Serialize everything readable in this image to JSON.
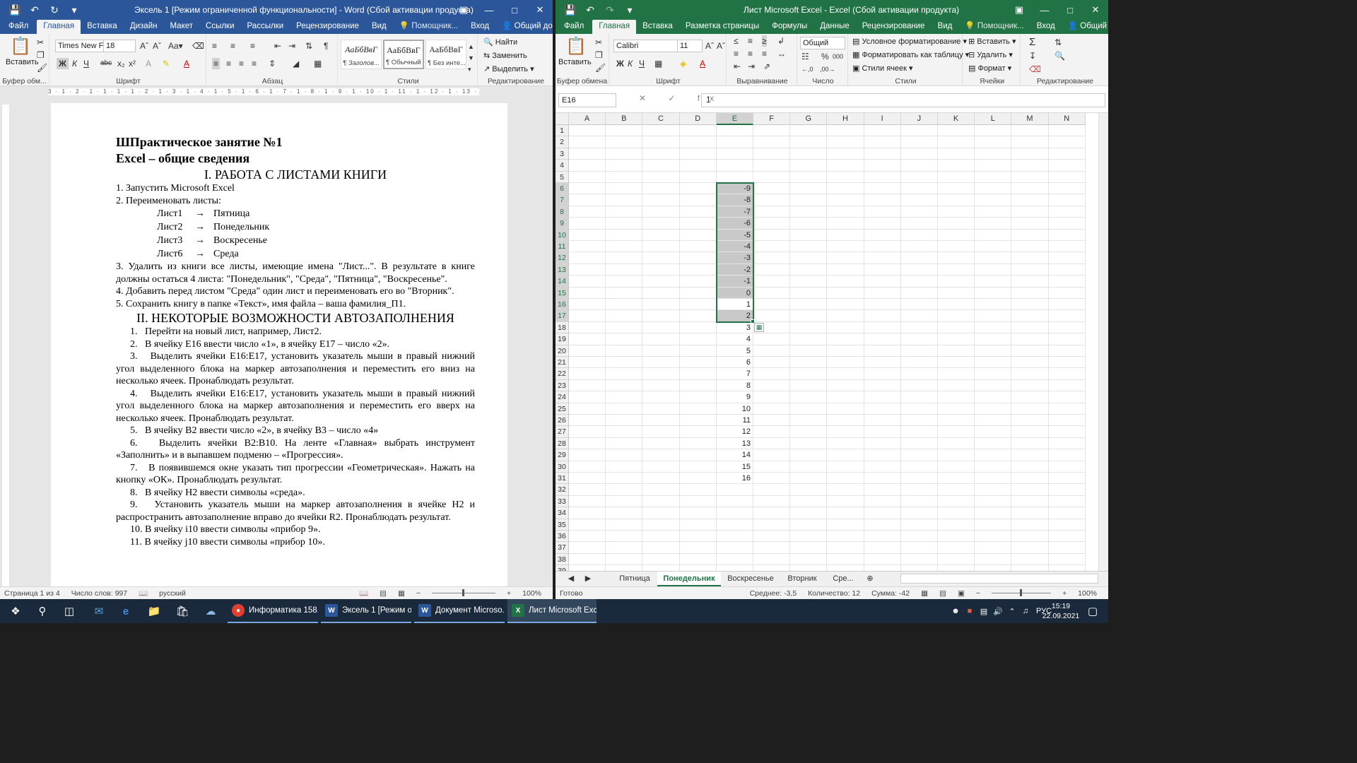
{
  "word": {
    "title": "Эксель 1 [Режим ограниченной функциональности] - Word (Сбой активации продукта)",
    "tabs": [
      "Файл",
      "Главная",
      "Вставка",
      "Дизайн",
      "Макет",
      "Ссылки",
      "Рассылки",
      "Рецензирование",
      "Вид",
      "Помощник...",
      "Вход",
      "Общий доступ"
    ],
    "ribbon": {
      "paste": "Вставить",
      "font_name": "Times New F",
      "font_size": "18",
      "styles": [
        {
          "preview": "АаБбВвГ",
          "name": "¶ Заголов..."
        },
        {
          "preview": "АаБбВвГ",
          "name": "¶ Обычный"
        },
        {
          "preview": "АаБбВвГ",
          "name": "¶ Без инте..."
        }
      ],
      "find": "Найти",
      "replace": "Заменить",
      "select": "Выделить",
      "groups": [
        "Буфер обм...",
        "Шрифт",
        "Абзац",
        "Стили",
        "Редактирование"
      ]
    },
    "ruler_text": "3 · 1 · 2 · 1 · 1 · 1 · 1 · 2 · 1 · 3 · 1 · 4 · 1 · 5 · 1 · 6 · 1 · 7 · 1 · 8 · 1 · 9 · 1 · 10 · 1 · 11 · 1 · 12 · 1 · 13 · 1 · 14 · 1 · 15 · 1 · 16 · 1 · 17",
    "doc": {
      "title1": "ШПрактическое занятие №1",
      "title2": "Excel – общие сведения",
      "section1": "I. РАБОТА С ЛИСТАМИ КНИГИ",
      "item1": "1. Запустить Microsoft Excel",
      "item2": "2. Переименовать листы:",
      "renames": [
        {
          "from": "Лист1",
          "arrow": "→",
          "to": "Пятница"
        },
        {
          "from": "Лист2",
          "arrow": "→",
          "to": "Понедельник"
        },
        {
          "from": "Лист3",
          "arrow": "→",
          "to": "Воскресенье"
        },
        {
          "from": "Лист6",
          "arrow": "→",
          "to": "Среда"
        }
      ],
      "item3": "3. Удалить из книги все листы, имеющие имена \"Лист...\". В результате в книге должны остаться 4 листа: \"Понедельник\", \"Среда\", \"Пятница\", \"Воскресенье\".",
      "item4": "4. Добавить перед листом \"Среда\" один лист и переименовать его во \"Вторник\".",
      "item5": "5. Сохранить книгу в папке «Текст», имя файла – ваша фамилия_П1.",
      "section2": "II. НЕКОТОРЫЕ ВОЗМОЖНОСТИ АВТОЗАПОЛНЕНИЯ",
      "steps": [
        "1.   Перейти на новый лист, например, Лист2.",
        "2.   В ячейку Е16 ввести число «1», в ячейку Е17 – число «2».",
        "3.   Выделить ячейки Е16:Е17, установить указатель мыши в правый нижний угол выделенного блока на маркер автозаполнения и переместить его вниз на несколько ячеек. Пронаблюдать результат.",
        "4.   Выделить ячейки Е16:Е17, установить указатель мыши в правый нижний угол выделенного блока на маркер автозаполнения и переместить его вверх на несколько ячеек. Пронаблюдать результат.",
        "5.   В ячейку В2 ввести число «2», в ячейку В3 – число «4»",
        "6.   Выделить ячейки В2:В10. На ленте «Главная» выбрать инструмент «Заполнить» и в выпавшем подменю – «Прогрессия».",
        "7.   В появившемся окне указать тип прогрессии «Геометрическая». Нажать на кнопку «ОК». Пронаблюдать результат.",
        "8.   В ячейку Н2 ввести символы «среда».",
        "9.   Установить указатель мыши на маркер автозаполнения в ячейке Н2 и распространить автозаполнение вправо до ячейки R2. Пронаблюдать результат.",
        "10. В ячейку i10 ввести символы «прибор 9».",
        "11. В ячейку j10 ввести символы «прибор 10»."
      ]
    },
    "status": {
      "page": "Страница 1 из 4",
      "words": "Число слов: 997",
      "lang": "русский",
      "zoom": "100%"
    }
  },
  "excel": {
    "title": "Лист Microsoft Excel - Excel (Сбой активации продукта)",
    "tabs": [
      "Файл",
      "Главная",
      "Вставка",
      "Разметка страницы",
      "Формулы",
      "Данные",
      "Рецензирование",
      "Вид",
      "Помощник...",
      "Вход",
      "Общий доступ"
    ],
    "ribbon": {
      "paste": "Вставить",
      "font_name": "Calibri",
      "font_size": "11",
      "number_format": "Общий",
      "cond_format": "Условное форматирование",
      "format_table": "Форматировать как таблицу",
      "cell_styles": "Стили ячеек",
      "insert": "Вставить",
      "delete": "Удалить",
      "format": "Формат",
      "groups": [
        "Буфер обмена",
        "Шрифт",
        "Выравнивание",
        "Число",
        "Стили",
        "Ячейки",
        "Редактирование"
      ]
    },
    "namebox": "E16",
    "formula": "1",
    "fx_icons": "✕ ✓ fx",
    "columns": [
      "A",
      "B",
      "C",
      "D",
      "E",
      "F",
      "G",
      "H",
      "I",
      "J",
      "K",
      "L",
      "M",
      "N"
    ],
    "rows": [
      "1",
      "2",
      "3",
      "4",
      "5",
      "6",
      "7",
      "8",
      "9",
      "10",
      "11",
      "12",
      "13",
      "14",
      "15",
      "16",
      "17",
      "18",
      "19",
      "20",
      "21",
      "22",
      "23",
      "24",
      "25",
      "26",
      "27",
      "28",
      "29",
      "30",
      "31",
      "32",
      "33",
      "34",
      "35",
      "36",
      "37",
      "38",
      "39"
    ],
    "e_values": [
      "",
      "",
      "",
      "",
      "",
      "-9",
      "-8",
      "-7",
      "-6",
      "-5",
      "-4",
      "-3",
      "-2",
      "-1",
      "0",
      "1",
      "2",
      "3",
      "4",
      "5",
      "6",
      "7",
      "8",
      "9",
      "10",
      "11",
      "12",
      "13",
      "14",
      "15",
      "16",
      "",
      "",
      "",
      "",
      "",
      "",
      "",
      ""
    ],
    "selection": {
      "first_row": "6",
      "last_row": "17",
      "active": "E16"
    },
    "sheets": [
      "Пятница",
      "Понедельник",
      "Воскресенье",
      "Вторник",
      "Сре..."
    ],
    "active_sheet": "Понедельник",
    "status": {
      "ready": "Готово",
      "avg": "Среднее: -3,5",
      "count": "Количество: 12",
      "sum": "Сумма: -42",
      "zoom": "100%"
    }
  },
  "taskbar": {
    "apps": [
      {
        "label": "Информатика 158...",
        "icon": "chrome-icon"
      },
      {
        "label": "Эксель 1 [Режим о...",
        "icon": "word-icon"
      },
      {
        "label": "Документ Microso...",
        "icon": "word-icon"
      },
      {
        "label": "Лист Microsoft Exc...",
        "icon": "excel-icon"
      }
    ],
    "lang": "РУС",
    "time": "15:19",
    "date": "22.09.2021"
  }
}
